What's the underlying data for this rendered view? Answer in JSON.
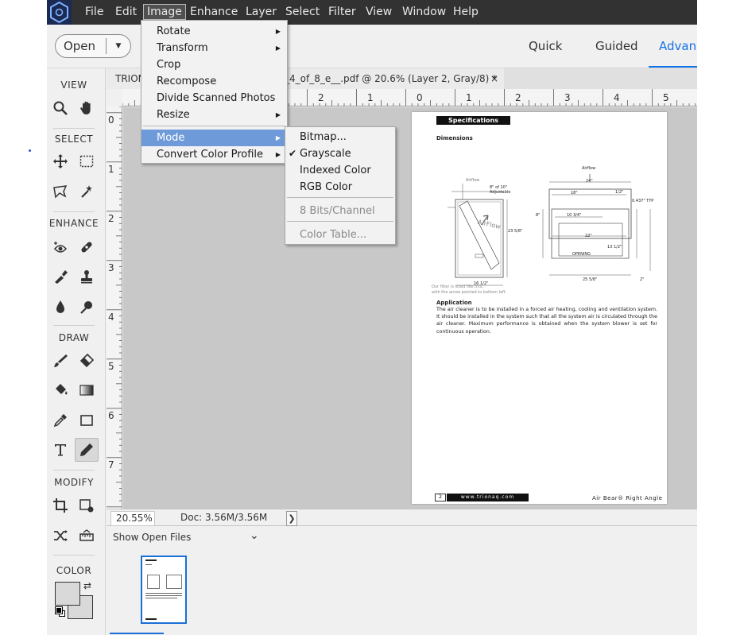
{
  "menubar": {
    "items": [
      "File",
      "Edit",
      "Image",
      "Enhance",
      "Layer",
      "Select",
      "Filter",
      "View",
      "Window",
      "Help"
    ],
    "active": "Image"
  },
  "topbar": {
    "open_label": "Open",
    "modes": [
      "Quick",
      "Guided",
      "Advanced"
    ],
    "active_mode": "Advanced",
    "advanced_visible": "Advanc"
  },
  "tools_panel": {
    "sections": {
      "view": "VIEW",
      "select": "SELECT",
      "enhance": "ENHANCE",
      "draw": "DRAW",
      "modify": "MODIFY",
      "color": "COLOR"
    },
    "icons": [
      "zoom-icon",
      "hand-icon",
      "move-icon",
      "marquee-icon",
      "lasso-icon",
      "magic-wand-icon",
      "red-eye-icon",
      "healing-brush-icon",
      "smart-brush-icon",
      "clone-stamp-icon",
      "blur-icon",
      "sponge-icon",
      "brush-icon",
      "eraser-icon",
      "paint-bucket-icon",
      "gradient-icon",
      "eyedropper-icon",
      "shape-icon",
      "type-icon",
      "pencil-icon",
      "crop-icon",
      "recompose-icon",
      "content-aware-move-icon",
      "straighten-icon"
    ],
    "selected_tool": "pencil-icon"
  },
  "document": {
    "tab_prefix": "TRION",
    "tab_suffix": "_4_of_8_e__.pdf @ 20.6% (Layer 2, Gray/8) *",
    "close": "×"
  },
  "rulers": {
    "top": [
      "2",
      "1",
      "0",
      "1",
      "2",
      "3",
      "4",
      "5"
    ],
    "left": [
      "0",
      "1",
      "2",
      "3",
      "4",
      "5",
      "6",
      "7"
    ]
  },
  "page": {
    "header": "Specifications",
    "dimensions_title": "Dimensions",
    "airflow_label": "Airflow",
    "airflow_right": "Airflow",
    "adjustable": "8\" of 10\"\nAdjustable",
    "arrow_text": "AirFlow",
    "dim_2350": "23 5/8\"",
    "dim_1612": "16 1/2\"",
    "dim_24": "24\"",
    "dim_18": "18\"",
    "dim_12": "1/2\"",
    "dim_0437": "0.437\" TYP",
    "dim_10": "10 3/4\"",
    "dim_8": "8\"",
    "dim_22": "22\"",
    "dim_1312": "13 1/2\"",
    "dim_2558": "25 5/8\"",
    "opening": "OPENING",
    "dim_2": "2\"",
    "caption_line1": "Our filter is sized like this,",
    "caption_line2": "with the arrow pointed to bottom left.",
    "application_title": "Application",
    "application_text": "The air cleaner is to be installed in a forced air heating, cooling and ventilation system. It should be installed in the system such that all the system air is circulated through the air cleaner. Maximum performance is obtained when the system blower is set for continuous operation.",
    "footer_num": "2",
    "footer_url": "www.trionaq.com",
    "footer_right": "Air Bear® Right Angle"
  },
  "status": {
    "zoom": "20.55%",
    "doc_size": "Doc: 3.56M/3.56M",
    "arrow": "❯"
  },
  "bin": {
    "select_label": "Show Open Files",
    "caret": "⌄"
  },
  "image_menu": {
    "items": [
      {
        "label": "Rotate",
        "submenu": true
      },
      {
        "label": "Transform",
        "submenu": true
      },
      {
        "label": "Crop",
        "submenu": false
      },
      {
        "label": "Recompose",
        "submenu": false
      },
      {
        "label": "Divide Scanned Photos",
        "submenu": false
      },
      {
        "label": "Resize",
        "submenu": true
      },
      {
        "label": "Mode",
        "submenu": true,
        "highlighted": true
      },
      {
        "label": "Convert Color Profile",
        "submenu": true
      }
    ]
  },
  "mode_menu": {
    "items": [
      {
        "label": "Bitmap...",
        "checked": false,
        "disabled": false
      },
      {
        "label": "Grayscale",
        "checked": true,
        "disabled": false
      },
      {
        "label": "Indexed Color",
        "checked": false,
        "disabled": false
      },
      {
        "label": "RGB Color",
        "checked": false,
        "disabled": false
      },
      {
        "label": "8 Bits/Channel",
        "checked": false,
        "disabled": true
      },
      {
        "label": "Color Table...",
        "checked": false,
        "disabled": true
      }
    ],
    "check": "✔"
  },
  "colors": {
    "accent": "#1473e6",
    "menubar_bg": "#323232",
    "highlight": "#6f9ad9"
  }
}
